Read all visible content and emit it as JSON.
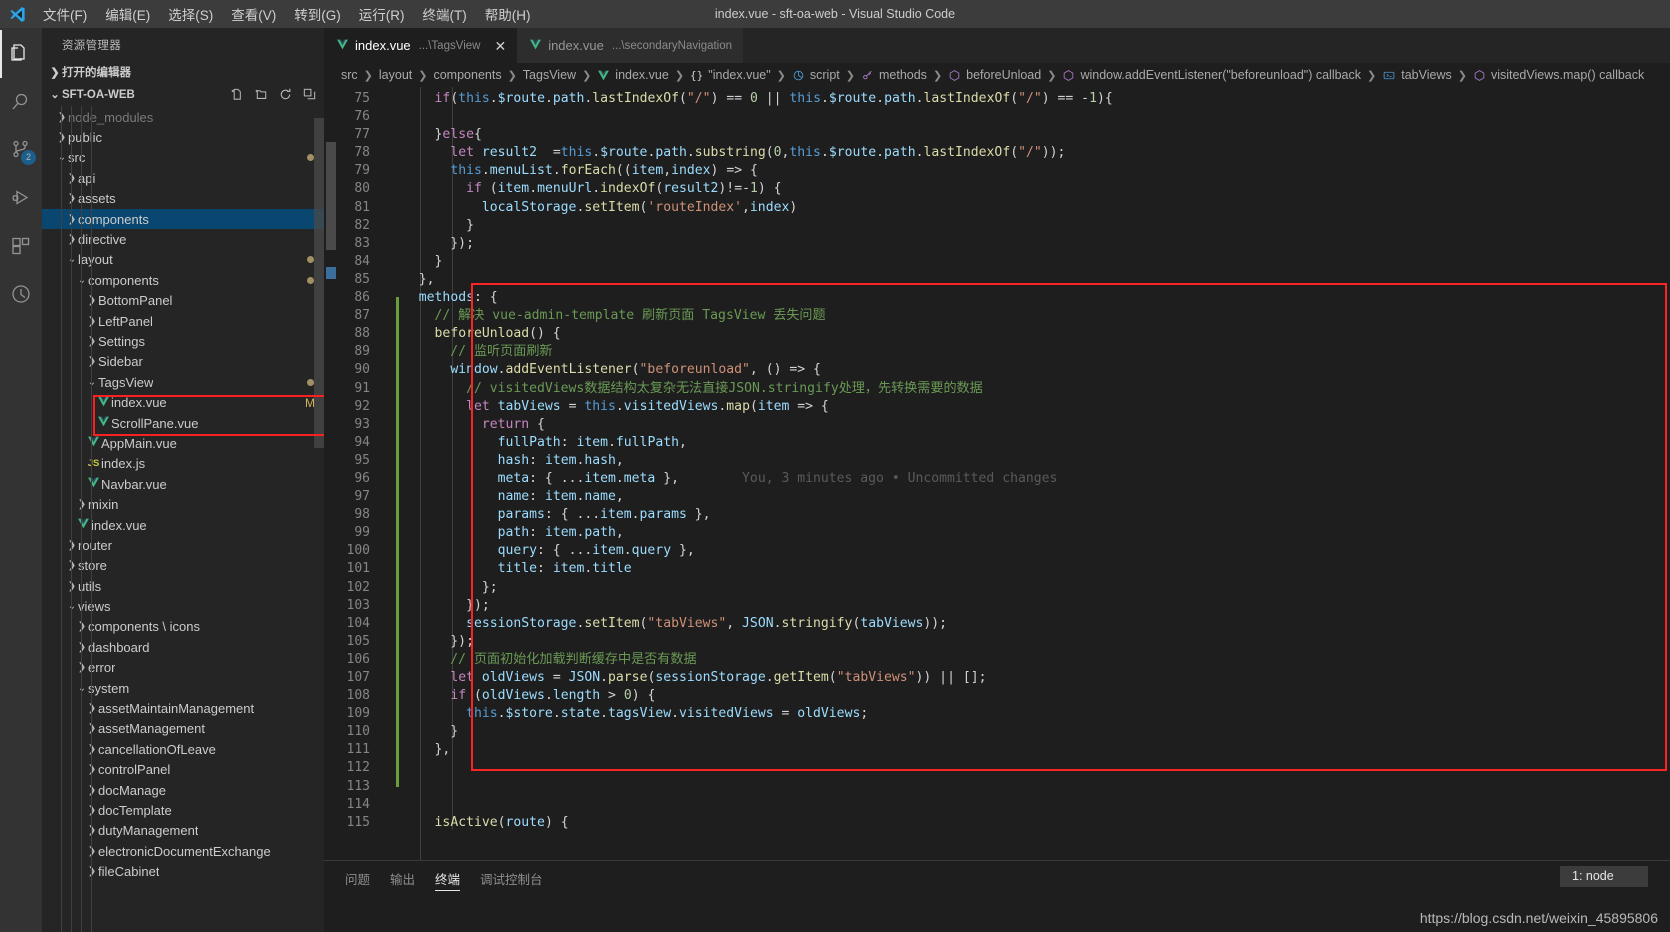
{
  "titlebar": {
    "logo_icon": "vscode-logo",
    "window_title": "index.vue - sft-oa-web - Visual Studio Code",
    "menus": [
      {
        "label": "文件(F)",
        "name": "menu-file"
      },
      {
        "label": "编辑(E)",
        "name": "menu-edit"
      },
      {
        "label": "选择(S)",
        "name": "menu-selection"
      },
      {
        "label": "查看(V)",
        "name": "menu-view"
      },
      {
        "label": "转到(G)",
        "name": "menu-go"
      },
      {
        "label": "运行(R)",
        "name": "menu-run"
      },
      {
        "label": "终端(T)",
        "name": "menu-terminal"
      },
      {
        "label": "帮助(H)",
        "name": "menu-help"
      }
    ]
  },
  "activitybar": {
    "items": [
      {
        "icon": "files-explorer-icon",
        "name": "activity-explorer",
        "active": true,
        "badge": ""
      },
      {
        "icon": "search-icon",
        "name": "activity-search",
        "active": false,
        "badge": ""
      },
      {
        "icon": "source-control-icon",
        "name": "activity-source-control",
        "active": false,
        "badge": "2"
      },
      {
        "icon": "run-debug-icon",
        "name": "activity-run-debug",
        "active": false,
        "badge": ""
      },
      {
        "icon": "extensions-icon",
        "name": "activity-extensions",
        "active": false,
        "badge": ""
      },
      {
        "icon": "clock-history-icon",
        "name": "activity-timeline",
        "active": false,
        "badge": ""
      }
    ]
  },
  "sidebar": {
    "title": "资源管理器",
    "open_editors_label": "打开的编辑器",
    "root_label": "SFT-OA-WEB",
    "root_actions": [
      {
        "icon": "new-file-icon",
        "name": "new-file-button"
      },
      {
        "icon": "new-folder-icon",
        "name": "new-folder-button"
      },
      {
        "icon": "refresh-icon",
        "name": "refresh-explorer-button"
      },
      {
        "icon": "collapse-all-icon",
        "name": "collapse-all-button"
      }
    ],
    "tree": [
      {
        "label": "node_modules",
        "indent": 1,
        "type": "folder",
        "state": "collapsed",
        "dimmed": true
      },
      {
        "label": "public",
        "indent": 1,
        "type": "folder",
        "state": "collapsed"
      },
      {
        "label": "src",
        "indent": 1,
        "type": "folder",
        "state": "expanded",
        "dot": true
      },
      {
        "label": "api",
        "indent": 2,
        "type": "folder",
        "state": "collapsed"
      },
      {
        "label": "assets",
        "indent": 2,
        "type": "folder",
        "state": "collapsed"
      },
      {
        "label": "components",
        "indent": 2,
        "type": "folder",
        "state": "collapsed",
        "selected": true
      },
      {
        "label": "directive",
        "indent": 2,
        "type": "folder",
        "state": "collapsed"
      },
      {
        "label": "layout",
        "indent": 2,
        "type": "folder",
        "state": "expanded",
        "dot": true
      },
      {
        "label": "components",
        "indent": 3,
        "type": "folder",
        "state": "expanded",
        "dot": true
      },
      {
        "label": "BottomPanel",
        "indent": 4,
        "type": "folder",
        "state": "collapsed"
      },
      {
        "label": "LeftPanel",
        "indent": 4,
        "type": "folder",
        "state": "collapsed"
      },
      {
        "label": "Settings",
        "indent": 4,
        "type": "folder",
        "state": "collapsed"
      },
      {
        "label": "Sidebar",
        "indent": 4,
        "type": "folder",
        "state": "collapsed"
      },
      {
        "label": "TagsView",
        "indent": 4,
        "type": "folder",
        "state": "expanded",
        "dot": true
      },
      {
        "label": "index.vue",
        "indent": 5,
        "type": "vue",
        "flag": "M"
      },
      {
        "label": "ScrollPane.vue",
        "indent": 5,
        "type": "vue"
      },
      {
        "label": "AppMain.vue",
        "indent": 4,
        "type": "vue"
      },
      {
        "label": "index.js",
        "indent": 4,
        "type": "js"
      },
      {
        "label": "Navbar.vue",
        "indent": 4,
        "type": "vue"
      },
      {
        "label": "mixin",
        "indent": 3,
        "type": "folder",
        "state": "collapsed"
      },
      {
        "label": "index.vue",
        "indent": 3,
        "type": "vue"
      },
      {
        "label": "router",
        "indent": 2,
        "type": "folder",
        "state": "collapsed"
      },
      {
        "label": "store",
        "indent": 2,
        "type": "folder",
        "state": "collapsed"
      },
      {
        "label": "utils",
        "indent": 2,
        "type": "folder",
        "state": "collapsed"
      },
      {
        "label": "views",
        "indent": 2,
        "type": "folder",
        "state": "expanded"
      },
      {
        "label": "components \\ icons",
        "indent": 3,
        "type": "folder",
        "state": "collapsed"
      },
      {
        "label": "dashboard",
        "indent": 3,
        "type": "folder",
        "state": "collapsed"
      },
      {
        "label": "error",
        "indent": 3,
        "type": "folder",
        "state": "collapsed"
      },
      {
        "label": "system",
        "indent": 3,
        "type": "folder",
        "state": "expanded"
      },
      {
        "label": "assetMaintainManagement",
        "indent": 4,
        "type": "folder",
        "state": "collapsed"
      },
      {
        "label": "assetManagement",
        "indent": 4,
        "type": "folder",
        "state": "collapsed"
      },
      {
        "label": "cancellationOfLeave",
        "indent": 4,
        "type": "folder",
        "state": "collapsed"
      },
      {
        "label": "controlPanel",
        "indent": 4,
        "type": "folder",
        "state": "collapsed"
      },
      {
        "label": "docManage",
        "indent": 4,
        "type": "folder",
        "state": "collapsed"
      },
      {
        "label": "docTemplate",
        "indent": 4,
        "type": "folder",
        "state": "collapsed"
      },
      {
        "label": "dutyManagement",
        "indent": 4,
        "type": "folder",
        "state": "collapsed"
      },
      {
        "label": "electronicDocumentExchange",
        "indent": 4,
        "type": "folder",
        "state": "collapsed"
      },
      {
        "label": "fileCabinet",
        "indent": 4,
        "type": "folder",
        "state": "collapsed"
      }
    ]
  },
  "editor": {
    "tabs": [
      {
        "name": "index.vue",
        "description": "...\\TagsView",
        "active": true,
        "icon": "vue-file-icon",
        "close_icon": "close-icon"
      },
      {
        "name": "index.vue",
        "description": "...\\secondaryNavigation",
        "active": false,
        "icon": "vue-file-icon"
      }
    ],
    "breadcrumb": [
      {
        "label": "src",
        "icon": ""
      },
      {
        "label": "layout",
        "icon": ""
      },
      {
        "label": "components",
        "icon": ""
      },
      {
        "label": "TagsView",
        "icon": ""
      },
      {
        "label": "index.vue",
        "icon": "vue-file-icon"
      },
      {
        "label": "\"index.vue\"",
        "icon": "braces-icon"
      },
      {
        "label": "script",
        "icon": "symbol-module-icon"
      },
      {
        "label": "methods",
        "icon": "symbol-key-icon"
      },
      {
        "label": "beforeUnload",
        "icon": "symbol-method-icon"
      },
      {
        "label": "window.addEventListener(\"beforeunload\") callback",
        "icon": "symbol-method-icon"
      },
      {
        "label": "tabViews",
        "icon": "symbol-variable-icon"
      },
      {
        "label": "visitedViews.map() callback",
        "icon": "symbol-method-icon"
      }
    ],
    "first_line_number": 75,
    "line_numbers": [
      75,
      76,
      77,
      78,
      79,
      80,
      81,
      82,
      83,
      84,
      85,
      86,
      87,
      88,
      89,
      90,
      91,
      92,
      93,
      94,
      95,
      96,
      97,
      98,
      99,
      100,
      101,
      102,
      103,
      104,
      105,
      106,
      107,
      108,
      109,
      110,
      111,
      112,
      113,
      114,
      115
    ],
    "blame_annotation": "You, 3 minutes ago • Uncommitted changes",
    "code_lines": [
      "    if(this.$route.path.lastIndexOf(\"/\") == 0 || this.$route.path.lastIndexOf(\"/\") == -1){",
      "",
      "    }else{",
      "      let result2  =this.$route.path.substring(0,this.$route.path.lastIndexOf(\"/\"));",
      "      this.menuList.forEach((item,index) => {",
      "        if (item.menuUrl.indexOf(result2)!=-1) {",
      "          localStorage.setItem('routeIndex',index)",
      "        }",
      "      });",
      "    }",
      "  },",
      "  methods: {",
      "    // 解决 vue-admin-template 刷新页面 TagsView 丢失问题",
      "    beforeUnload() {",
      "      // 监听页面刷新",
      "      window.addEventListener(\"beforeunload\", () => {",
      "        // visitedViews数据结构太复杂无法直接JSON.stringify处理，先转换需要的数据",
      "        let tabViews = this.visitedViews.map(item => {",
      "          return {",
      "            fullPath: item.fullPath,",
      "            hash: item.hash,",
      "            meta: { ...item.meta },",
      "            name: item.name,",
      "            params: { ...item.params },",
      "            path: item.path,",
      "            query: { ...item.query },",
      "            title: item.title",
      "          };",
      "        });",
      "        sessionStorage.setItem(\"tabViews\", JSON.stringify(tabViews));",
      "      });",
      "      // 页面初始化加载判断缓存中是否有数据",
      "      let oldViews = JSON.parse(sessionStorage.getItem(\"tabViews\")) || [];",
      "      if (oldViews.length > 0) {",
      "        this.$store.state.tagsView.visitedViews = oldViews;",
      "      }",
      "    },",
      "",
      "",
      "",
      "    isActive(route) {"
    ]
  },
  "panel": {
    "tabs": [
      {
        "label": "问题",
        "name": "panel-tab-problems",
        "active": false
      },
      {
        "label": "输出",
        "name": "panel-tab-output",
        "active": false
      },
      {
        "label": "终端",
        "name": "panel-tab-terminal",
        "active": true
      },
      {
        "label": "调试控制台",
        "name": "panel-tab-debug-console",
        "active": false
      }
    ],
    "terminal_selector": "1: node"
  },
  "watermark": "https://blog.csdn.net/weixin_45895806",
  "colors": {
    "accent": "#0e7ac4",
    "highlight_box": "#fb2424",
    "selection": "#094771",
    "modified_flag": "#d3b15e"
  }
}
